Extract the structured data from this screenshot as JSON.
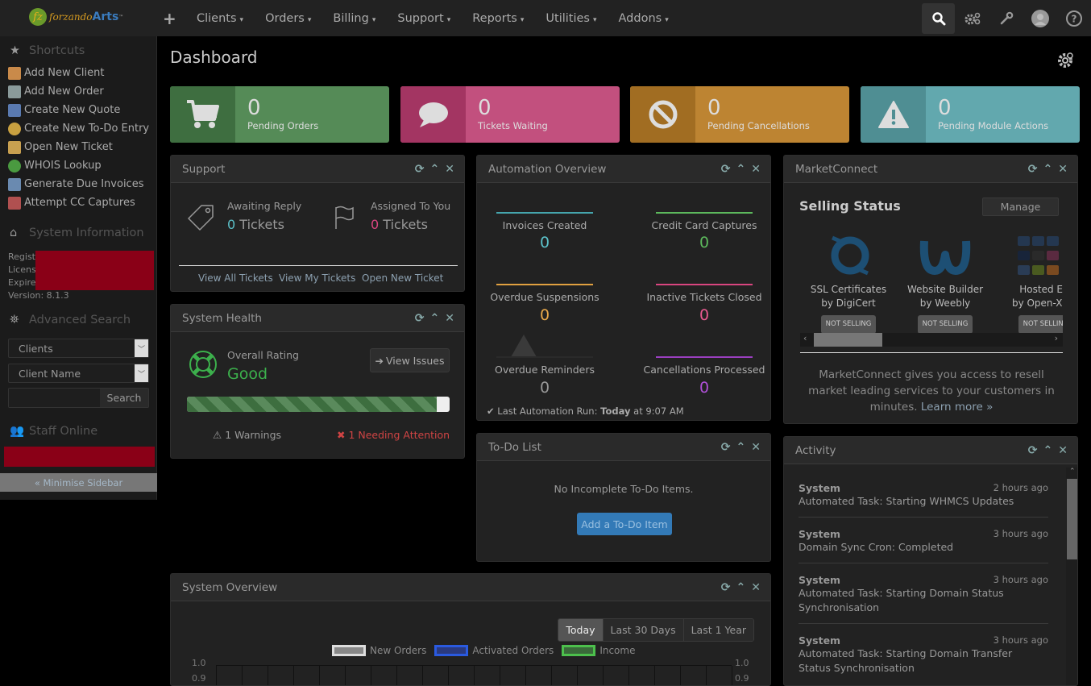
{
  "brand": {
    "logo_mark": "fz",
    "name_part1": "forzando",
    "name_part2": "Arts",
    "tm": "™"
  },
  "topnav": {
    "add_icon": "+",
    "menu": [
      {
        "label": "Clients"
      },
      {
        "label": "Orders"
      },
      {
        "label": "Billing"
      },
      {
        "label": "Support"
      },
      {
        "label": "Reports"
      },
      {
        "label": "Utilities"
      },
      {
        "label": "Addons"
      }
    ],
    "caret": "▾",
    "right_icons": [
      "search-icon",
      "automation-gears-icon",
      "wrench-icon",
      "user-avatar",
      "help-icon"
    ]
  },
  "sidebar": {
    "shortcuts_title": "Shortcuts",
    "shortcuts": [
      {
        "label": "Add New Client",
        "icon_color": "#c98a4a"
      },
      {
        "label": "Add New Order",
        "icon_color": "#9aa"
      },
      {
        "label": "Create New Quote",
        "icon_color": "#5a7ab0"
      },
      {
        "label": "Create New To-Do Entry",
        "icon_color": "#c8a040"
      },
      {
        "label": "Open New Ticket",
        "icon_color": "#c8a050"
      },
      {
        "label": "WHOIS Lookup",
        "icon_color": "#4a9a40"
      },
      {
        "label": "Generate Due Invoices",
        "icon_color": "#6a8ab0"
      },
      {
        "label": "Attempt CC Captures",
        "icon_color": "#b05050"
      }
    ],
    "sysinfo_title": "System Information",
    "sysinfo": {
      "registered": "Registe",
      "license": "Licens",
      "expires": "Expire",
      "version": "Version: 8.1.3"
    },
    "adv_search_title": "Advanced Search",
    "adv_search": {
      "type_value": "Clients",
      "field_value": "Client Name",
      "query": "",
      "search_button": "Search"
    },
    "staff_title": "Staff Online",
    "minimise": "« Minimise Sidebar"
  },
  "page": {
    "title": "Dashboard"
  },
  "stats": [
    {
      "value": "0",
      "label": "Pending Orders",
      "color": "#558b57",
      "icon_bg": "#3e6e40"
    },
    {
      "value": "0",
      "label": "Tickets Waiting",
      "color": "#c2507e",
      "icon_bg": "#a33562"
    },
    {
      "value": "0",
      "label": "Pending Cancellations",
      "color": "#bd8432",
      "icon_bg": "#a16d22"
    },
    {
      "value": "0",
      "label": "Pending Module Actions",
      "color": "#62a8ae",
      "icon_bg": "#4f8e93"
    }
  ],
  "support": {
    "title": "Support",
    "awaiting_label": "Awaiting Reply",
    "awaiting_count": "0",
    "awaiting_unit": "Tickets",
    "assigned_label": "Assigned To You",
    "assigned_count": "0",
    "assigned_unit": "Tickets",
    "links": [
      "View All Tickets",
      "View My Tickets",
      "Open New Ticket"
    ]
  },
  "health": {
    "title": "System Health",
    "rating_label": "Overall Rating",
    "rating": "Good",
    "view_issues": "View Issues",
    "progress_percent": 95,
    "warnings": "1 Warnings",
    "attention": "1 Needing Attention"
  },
  "automation": {
    "title": "Automation Overview",
    "items": [
      {
        "label": "Invoices Created",
        "value": "0",
        "color": "#45a5ad"
      },
      {
        "label": "Credit Card Captures",
        "value": "0",
        "color": "#5cb85c"
      },
      {
        "label": "Overdue Suspensions",
        "value": "0",
        "color": "#e0a040"
      },
      {
        "label": "Inactive Tickets Closed",
        "value": "0",
        "color": "#d9457f"
      },
      {
        "label": "Overdue Reminders",
        "value": "0",
        "color": "#333"
      },
      {
        "label": "Cancellations Processed",
        "value": "0",
        "color": "#9b3fc0"
      }
    ],
    "last_run_prefix": "Last Automation Run:",
    "last_run_day": "Today",
    "last_run_suffix": "at 9:07 AM"
  },
  "todo": {
    "title": "To-Do List",
    "empty": "No Incomplete To-Do Items.",
    "add_button": "Add a To-Do Item"
  },
  "marketconnect": {
    "title": "MarketConnect",
    "selling_title": "Selling Status",
    "manage": "Manage",
    "items": [
      {
        "line1": "SSL Certificates",
        "line2": "by DigiCert",
        "status": "NOT SELLING"
      },
      {
        "line1": "Website Builder",
        "line2": "by Weebly",
        "status": "NOT SELLING"
      },
      {
        "line1": "Hosted Em",
        "line2": "by Open-Xcha",
        "status": "NOT SELLING"
      }
    ],
    "desc": "MarketConnect gives you access to resell market leading services to your customers in minutes.",
    "learn_more": "Learn more »"
  },
  "activity": {
    "title": "Activity",
    "items": [
      {
        "who": "System",
        "when": "2 hours ago",
        "msg": "Automated Task: Starting WHMCS Updates"
      },
      {
        "who": "System",
        "when": "3 hours ago",
        "msg": "Domain Sync Cron: Completed"
      },
      {
        "who": "System",
        "when": "3 hours ago",
        "msg": "Automated Task: Starting Domain Status Synchronisation"
      },
      {
        "who": "System",
        "when": "3 hours ago",
        "msg": "Automated Task: Starting Domain Transfer Status Synchronisation"
      }
    ]
  },
  "overview": {
    "title": "System Overview",
    "ranges": [
      "Today",
      "Last 30 Days",
      "Last 1 Year"
    ],
    "active_range": "Today",
    "legend": [
      {
        "name": "New Orders",
        "border": "#ddd",
        "fill": "#888"
      },
      {
        "name": "Activated Orders",
        "border": "#2a5ae0",
        "fill": "#2a3a80"
      },
      {
        "name": "Income",
        "border": "#4cc04c",
        "fill": "#3a6a3a"
      }
    ],
    "y_ticks_left": [
      "1.0",
      "0.9"
    ],
    "y_ticks_right": [
      "1.0",
      "0.9"
    ]
  }
}
